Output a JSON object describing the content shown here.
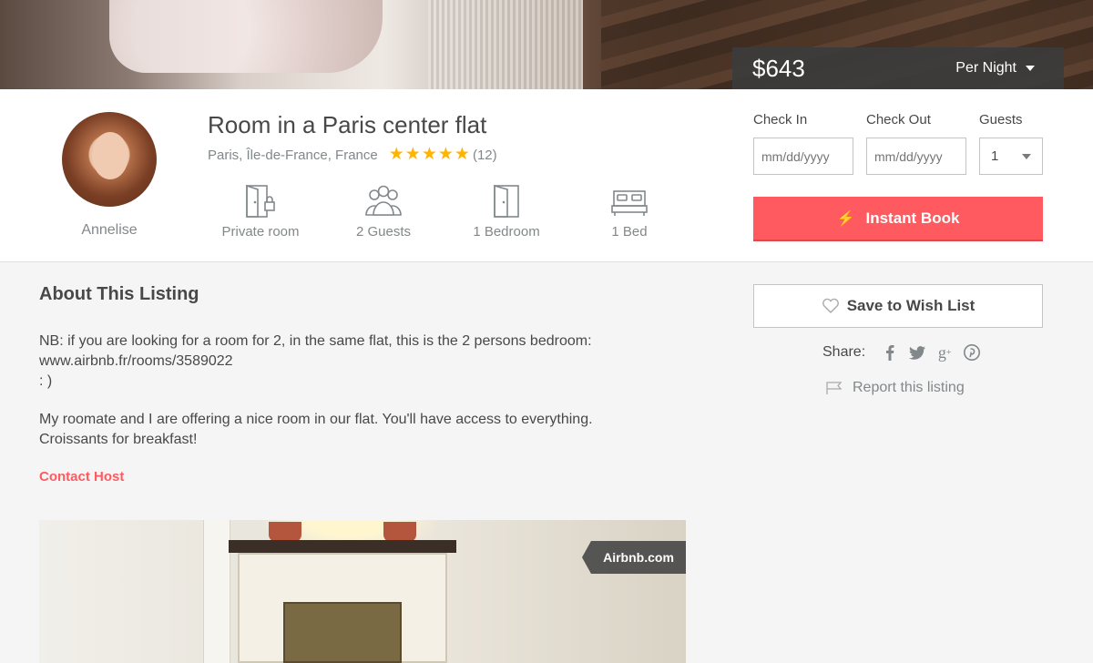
{
  "price_bar": {
    "price": "$643",
    "period": "Per Night"
  },
  "host": {
    "name": "Annelise"
  },
  "listing": {
    "title": "Room in a Paris center flat",
    "location": "Paris, Île-de-France, France",
    "rating_stars": 5,
    "review_count": "(12)",
    "features": [
      {
        "icon": "door-lock-icon",
        "label": "Private room"
      },
      {
        "icon": "guests-icon",
        "label": "2 Guests"
      },
      {
        "icon": "door-icon",
        "label": "1 Bedroom"
      },
      {
        "icon": "bed-icon",
        "label": "1 Bed"
      }
    ]
  },
  "booking": {
    "check_in_label": "Check In",
    "check_out_label": "Check Out",
    "guests_label": "Guests",
    "check_in_placeholder": "mm/dd/yyyy",
    "check_out_placeholder": "mm/dd/yyyy",
    "guests_value": "1",
    "instant_book_label": "Instant Book"
  },
  "about": {
    "title": "About This Listing",
    "para1_line1": "NB: if you are looking for a room for 2, in the same flat, this is the 2 persons bedroom:",
    "para1_line2": "www.airbnb.fr/rooms/3589022",
    "para1_line3": ": )",
    "para2_line1": "My roomate and I are offering a nice room in our flat. You'll have access to everything.",
    "para2_line2": "Croissants for breakfast!",
    "contact_label": "Contact Host",
    "photo_watermark": "Airbnb.com"
  },
  "sidebar": {
    "wishlist_label": "Save to Wish List",
    "share_label": "Share:",
    "share_icons": [
      "facebook-icon",
      "twitter-icon",
      "google-plus-icon",
      "pinterest-icon"
    ],
    "report_label": "Report this listing"
  },
  "colors": {
    "accent": "#ff5a5f",
    "star": "#ffb400",
    "text": "#484848",
    "muted": "#82888a"
  }
}
